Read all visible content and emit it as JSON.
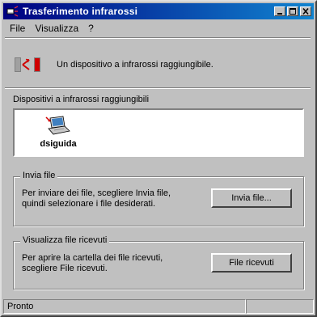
{
  "window": {
    "title": "Trasferimento infrarossi",
    "icon": "infrared-transfer-icon"
  },
  "menu": {
    "items": [
      "File",
      "Visualizza",
      "?"
    ]
  },
  "status": {
    "icon": "infrared-signal-icon",
    "text": "Un dispositivo a infrarossi raggiungibile."
  },
  "devices": {
    "label": "Dispositivi a infrarossi raggiungibili",
    "items": [
      {
        "name": "dsiguida",
        "icon": "laptop-icon"
      }
    ]
  },
  "send_group": {
    "title": "Invia file",
    "description": "Per inviare dei file, scegliere Invia file, quindi selezionare i file desiderati.",
    "button_label": "Invia file..."
  },
  "received_group": {
    "title": "Visualizza file ricevuti",
    "description": "Per aprire la cartella dei file ricevuti, scegliere File ricevuti.",
    "button_label": "File ricevuti"
  },
  "statusbar": {
    "text": "Pronto"
  },
  "colors": {
    "titlebar_start": "#000080",
    "titlebar_end": "#1084d0",
    "window_face": "#c0c0c0",
    "ir_red": "#d00000"
  }
}
